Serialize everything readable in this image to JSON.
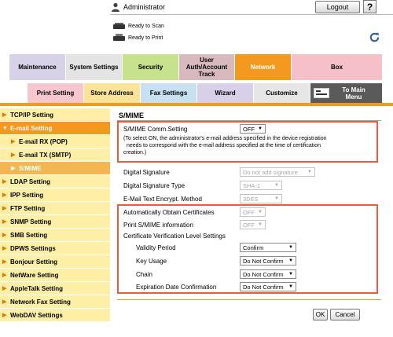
{
  "header": {
    "user_label": "Administrator",
    "logout_label": "Logout",
    "help_label": "?",
    "status_scan": "Ready to Scan",
    "status_print": "Ready to Print"
  },
  "main_tabs": [
    {
      "label": "Maintenance"
    },
    {
      "label": "System Settings"
    },
    {
      "label": "Security"
    },
    {
      "label": "User Auth/Account Track"
    },
    {
      "label": "Network"
    },
    {
      "label": "Box"
    }
  ],
  "sub_tabs": [
    {
      "label": "Print Setting"
    },
    {
      "label": "Store Address"
    },
    {
      "label": "Fax Settings"
    },
    {
      "label": "Wizard"
    },
    {
      "label": "Customize"
    },
    {
      "label": "To Main Menu"
    }
  ],
  "sidebar": {
    "items": [
      {
        "label": "TCP/IP Setting"
      },
      {
        "label": "E-mail Setting"
      },
      {
        "label": "E-mail RX (POP)"
      },
      {
        "label": "E-mail TX (SMTP)"
      },
      {
        "label": "S/MIME"
      },
      {
        "label": "LDAP Setting"
      },
      {
        "label": "IPP Setting"
      },
      {
        "label": "FTP Setting"
      },
      {
        "label": "SNMP Setting"
      },
      {
        "label": "SMB Setting"
      },
      {
        "label": "DPWS Settings"
      },
      {
        "label": "Bonjour Setting"
      },
      {
        "label": "NetWare Setting"
      },
      {
        "label": "AppleTalk Setting"
      },
      {
        "label": "Network Fax Setting"
      },
      {
        "label": "WebDAV Settings"
      }
    ]
  },
  "content": {
    "title": "S/MIME",
    "comm_setting_label": "S/MIME Comm.Setting",
    "comm_setting_value": "OFF",
    "note_line1": "(To select ON, the administrator's e-mail address specified in the device registration",
    "note_line2": "needs to correspond with the e-mail address specified at the time of certification",
    "note_line3": "creation.)",
    "digital_signature_label": "Digital Signature",
    "digital_signature_value": "Do not add signature",
    "digital_signature_type_label": "Digital Signature Type",
    "digital_signature_type_value": "SHA-1",
    "encrypt_method_label": "E-Mail Text Encrypt. Method",
    "encrypt_method_value": "3DES",
    "auto_obtain_label": "Automatically Obtain Certificates",
    "auto_obtain_value": "OFF",
    "print_info_label": "Print S/MIME information",
    "print_info_value": "OFF",
    "cert_verify_label": "Certificate Verification Level Settings",
    "validity_label": "Validity Period",
    "validity_value": "Confirm",
    "key_usage_label": "Key Usage",
    "key_usage_value": "Do Not Confirm",
    "chain_label": "Chain",
    "chain_value": "Do Not Confirm",
    "expiration_label": "Expiration Date Confirmation",
    "expiration_value": "Do Not Confirm",
    "ok_label": "OK",
    "cancel_label": "Cancel"
  },
  "colors": {
    "accent_orange": "#f39a1e",
    "highlight_red": "#ee5a3a",
    "sidebar_yellow": "#fdf0a6"
  }
}
